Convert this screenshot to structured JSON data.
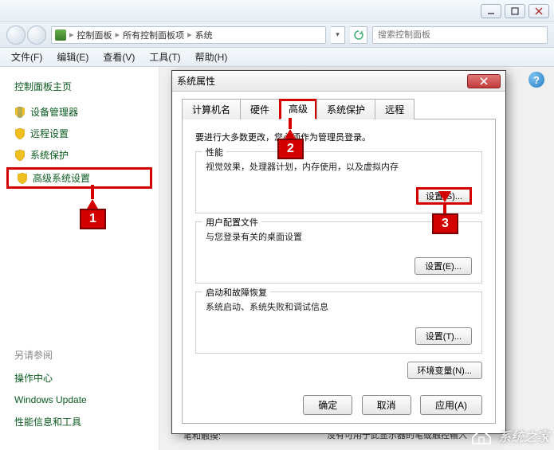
{
  "window": {
    "min_tip": "最小化",
    "max_tip": "最大化",
    "close_tip": "关闭"
  },
  "breadcrumb": {
    "icon": "control-panel",
    "segs": [
      "控制面板",
      "所有控制面板项",
      "系统"
    ]
  },
  "search": {
    "placeholder": "搜索控制面板"
  },
  "menu": {
    "file": "文件(F)",
    "edit": "编辑(E)",
    "view": "查看(V)",
    "tools": "工具(T)",
    "help": "帮助(H)"
  },
  "sidebar": {
    "home": "控制面板主页",
    "items": [
      {
        "label": "设备管理器"
      },
      {
        "label": "远程设置"
      },
      {
        "label": "系统保护"
      },
      {
        "label": "高级系统设置"
      }
    ],
    "seealso_title": "另请参阅",
    "seealso": [
      {
        "label": "操作中心"
      },
      {
        "label": "Windows Update"
      },
      {
        "label": "性能信息和工具"
      }
    ]
  },
  "content_behind": {
    "pen": "笔和触摸:",
    "pen_val": "没有可用于此显示器的笔或触控输入"
  },
  "dialog": {
    "title": "系统属性",
    "tabs": {
      "computer": "计算机名",
      "hardware": "硬件",
      "advanced": "高级",
      "protect": "系统保护",
      "remote": "远程"
    },
    "intro": "要进行大多数更改，您必须作为管理员登录。",
    "perf": {
      "title": "性能",
      "desc": "视觉效果，处理器计划，内存使用，以及虚拟内存",
      "btn": "设置(S)..."
    },
    "profile": {
      "title": "用户配置文件",
      "desc": "与您登录有关的桌面设置",
      "btn": "设置(E)..."
    },
    "startup": {
      "title": "启动和故障恢复",
      "desc": "系统启动、系统失败和调试信息",
      "btn": "设置(T)..."
    },
    "env": "环境变量(N)...",
    "ok": "确定",
    "cancel": "取消",
    "apply": "应用(A)"
  },
  "annotations": {
    "n1": "1",
    "n2": "2",
    "n3": "3"
  },
  "watermark": "系统之家"
}
